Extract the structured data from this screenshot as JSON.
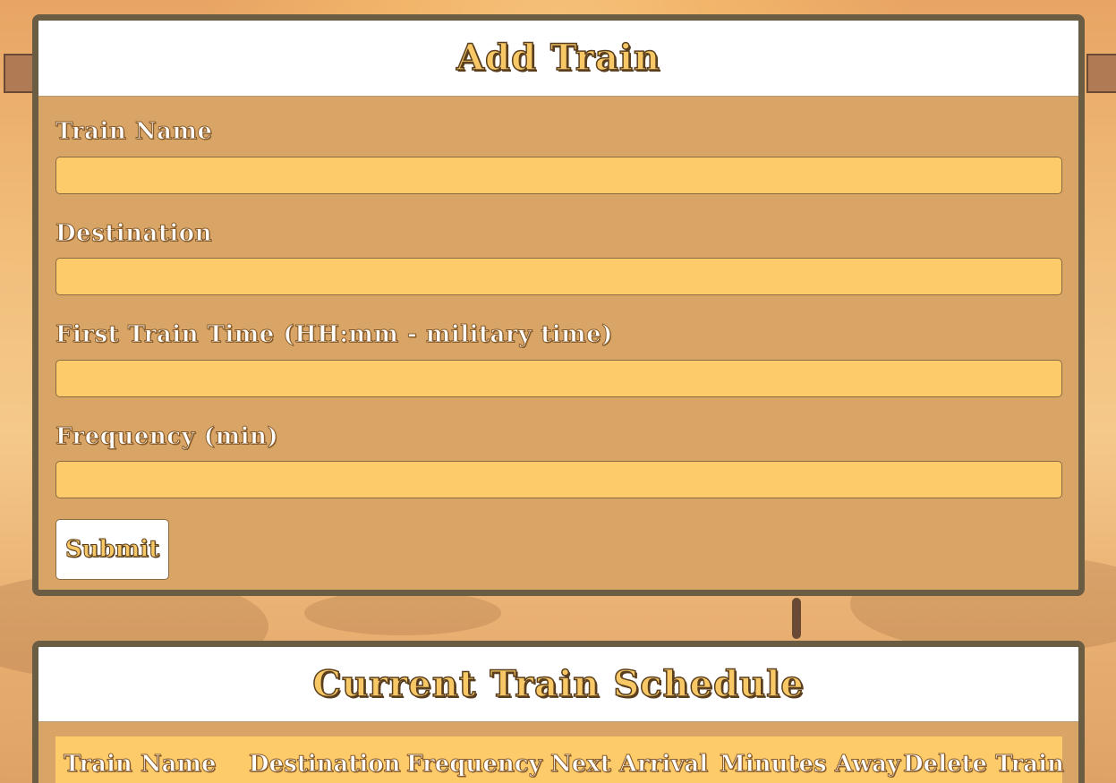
{
  "add_train": {
    "title": "Add Train",
    "fields": [
      {
        "label": "Train Name",
        "value": ""
      },
      {
        "label": "Destination",
        "value": ""
      },
      {
        "label": "First Train Time (HH:mm - military time)",
        "value": ""
      },
      {
        "label": "Frequency (min)",
        "value": ""
      }
    ],
    "submit_label": "Submit"
  },
  "schedule": {
    "title": "Current Train Schedule",
    "columns": [
      "Train Name",
      "Destination",
      "Frequency",
      "Next Arrival",
      "Minutes Away",
      "Delete Train"
    ]
  },
  "colors": {
    "panel": "#d9a567",
    "border": "#6b5d43",
    "input": "#fecb6b",
    "title_text": "#f7c865"
  }
}
